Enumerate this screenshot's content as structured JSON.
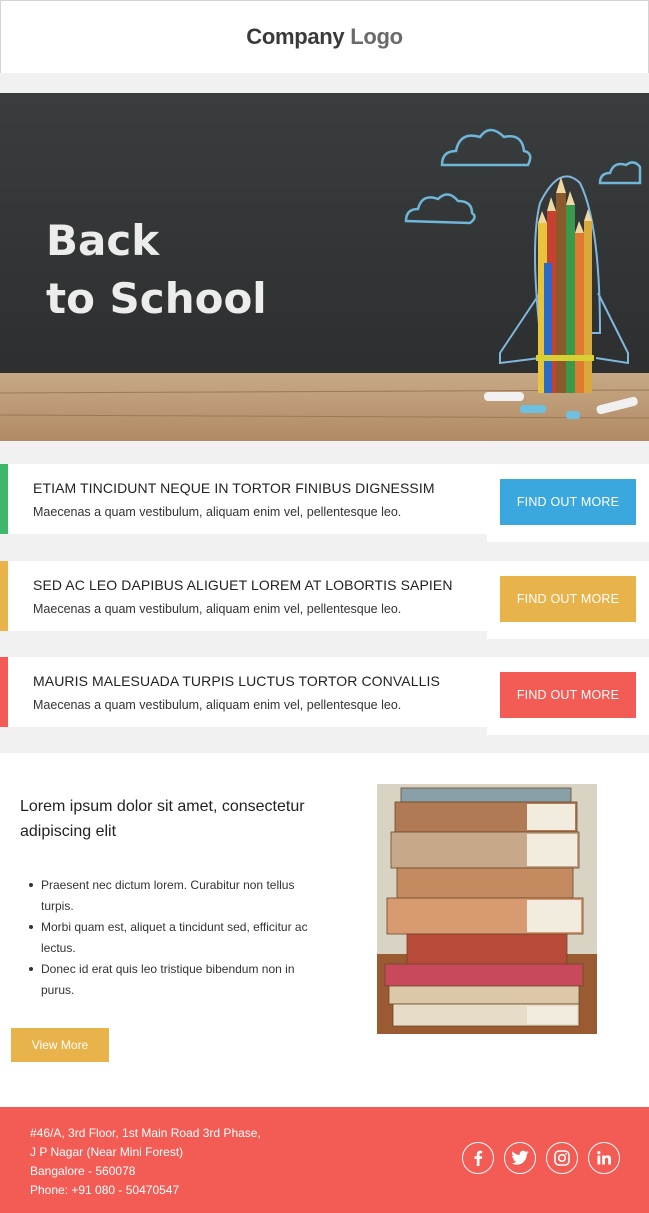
{
  "header": {
    "logo_part1": "Company",
    "logo_part2": "Logo"
  },
  "hero": {
    "line1": "Back",
    "line2": "to School"
  },
  "features": [
    {
      "title": "ETIAM TINCIDUNT NEQUE IN TORTOR FINIBUS DIGNESSIM",
      "desc": "Maecenas a quam vestibulum, aliquam enim vel, pellentesque leo.",
      "button": "FIND OUT MORE",
      "accent": "#3fb76a",
      "button_color": "#3aa8de"
    },
    {
      "title": "SED AC LEO DAPIBUS ALIGUET LOREM AT LOBORTIS SAPIEN",
      "desc": "Maecenas a quam vestibulum, aliquam enim vel, pellentesque leo.",
      "button": "FIND OUT MORE",
      "accent": "#e8b34a",
      "button_color": "#e8b34a"
    },
    {
      "title": "MAURIS MALESUADA TURPIS LUCTUS TORTOR CONVALLIS",
      "desc": "Maecenas a quam vestibulum, aliquam enim vel, pellentesque leo.",
      "button": "FIND OUT MORE",
      "accent": "#f35c54",
      "button_color": "#f35c54"
    }
  ],
  "content": {
    "heading": "Lorem ipsum dolor sit amet, consectetur adipiscing elit",
    "bullets": [
      "Praesent nec dictum lorem. Curabitur non tellus turpis.",
      "Morbi quam est, aliquet a tincidunt sed, efficitur ac lectus.",
      "Donec id erat quis leo tristique bibendum non in purus."
    ],
    "view_more": "View More"
  },
  "footer": {
    "address": [
      "#46/A, 3rd Floor, 1st Main Road 3rd Phase,",
      "J P Nagar (Near Mini Forest)",
      "Bangalore - 560078",
      "Phone: +91 080 - 50470547"
    ],
    "social_icons": [
      "facebook-icon",
      "twitter-icon",
      "instagram-icon",
      "linkedin-icon"
    ]
  }
}
